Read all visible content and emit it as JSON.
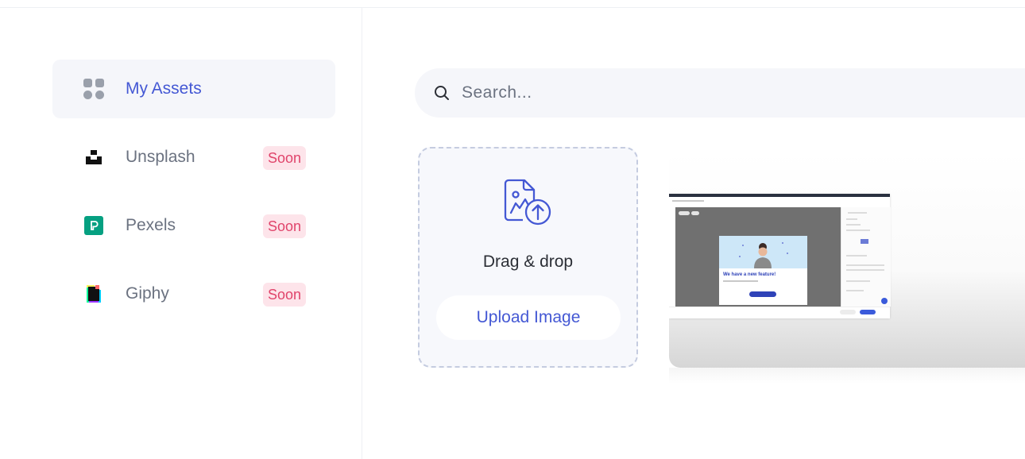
{
  "sidebar": {
    "items": [
      {
        "label": "My Assets",
        "icon": "grid-icon",
        "active": true
      },
      {
        "label": "Unsplash",
        "icon": "unsplash-logo-icon",
        "badge": "Soon"
      },
      {
        "label": "Pexels",
        "icon": "pexels-logo-icon",
        "badge": "Soon"
      },
      {
        "label": "Giphy",
        "icon": "giphy-logo-icon",
        "badge": "Soon"
      }
    ]
  },
  "search": {
    "placeholder": "Search..."
  },
  "upload": {
    "drag_text": "Drag & drop",
    "button_label": "Upload Image"
  },
  "thumbnail": {
    "headline": "We have a new feature!"
  },
  "colors": {
    "accent": "#4458d4",
    "badge_bg": "#fde4ea",
    "badge_text": "#e0446b",
    "pexels_green": "#05a081"
  }
}
